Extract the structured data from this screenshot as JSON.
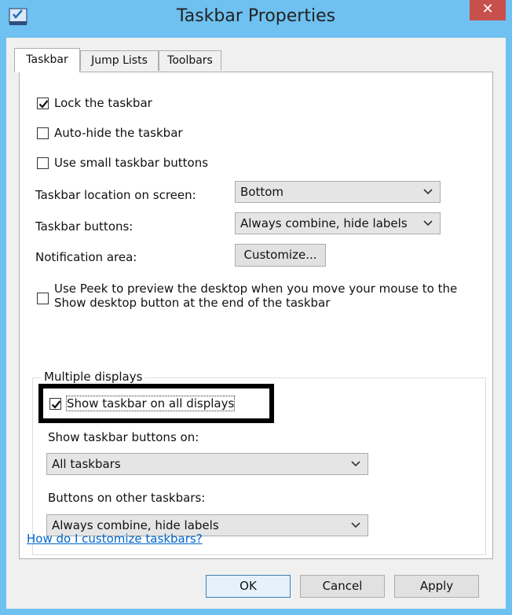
{
  "window": {
    "title": "Taskbar Properties",
    "close_glyph": "✕"
  },
  "tabs": [
    {
      "label": "Taskbar",
      "active": true
    },
    {
      "label": "Jump Lists",
      "active": false
    },
    {
      "label": "Toolbars",
      "active": false
    }
  ],
  "options": {
    "lock": {
      "label": "Lock the taskbar",
      "checked": true
    },
    "autohide": {
      "label": "Auto-hide the taskbar",
      "checked": false
    },
    "small_buttons": {
      "label": "Use small taskbar buttons",
      "checked": false
    }
  },
  "location": {
    "label": "Taskbar location on screen:",
    "value": "Bottom"
  },
  "buttons": {
    "label": "Taskbar buttons:",
    "value": "Always combine, hide labels"
  },
  "notification": {
    "label": "Notification area:",
    "button": "Customize..."
  },
  "peek": {
    "line1": "Use Peek to preview the desktop when you move your mouse to the",
    "line2": "Show desktop button at the end of the taskbar",
    "checked": false
  },
  "multiple_displays": {
    "title": "Multiple displays",
    "show_all": {
      "label": "Show taskbar on all displays",
      "checked": true
    },
    "show_buttons_on": {
      "label": "Show taskbar buttons on:",
      "value": "All taskbars"
    },
    "other_buttons": {
      "label": "Buttons on other taskbars:",
      "value": "Always combine, hide labels"
    }
  },
  "help_link": "How do I customize taskbars?",
  "footer": {
    "ok": "OK",
    "cancel": "Cancel",
    "apply": "Apply"
  }
}
